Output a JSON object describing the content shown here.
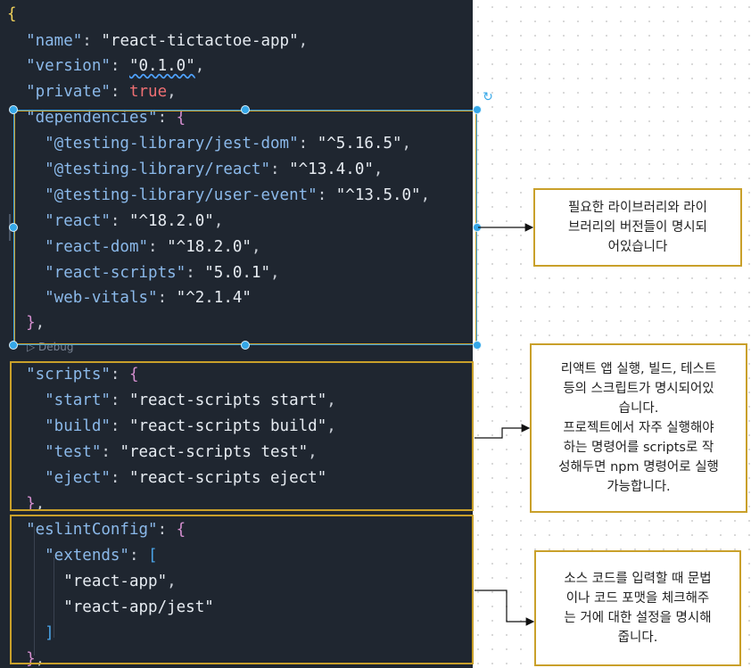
{
  "code_lines": [
    {
      "parts": [
        {
          "c": "yb",
          "t": "{"
        }
      ]
    },
    {
      "parts": [
        {
          "c": "k",
          "t": "  \"name\""
        },
        {
          "c": "p",
          "t": ": "
        },
        {
          "c": "s",
          "t": "\"react-tictactoe-app\""
        },
        {
          "c": "p",
          "t": ","
        }
      ]
    },
    {
      "parts": [
        {
          "c": "k",
          "t": "  \"version\""
        },
        {
          "c": "p",
          "t": ": "
        },
        {
          "c": "s squig",
          "t": "\"0.1.0\""
        },
        {
          "c": "p",
          "t": ","
        }
      ]
    },
    {
      "parts": [
        {
          "c": "k",
          "t": "  \"private\""
        },
        {
          "c": "p",
          "t": ": "
        },
        {
          "c": "t",
          "t": "true"
        },
        {
          "c": "p",
          "t": ","
        }
      ]
    },
    {
      "parts": [
        {
          "c": "k",
          "t": "  \"dependencies\""
        },
        {
          "c": "p",
          "t": ": "
        },
        {
          "c": "b",
          "t": "{"
        }
      ]
    },
    {
      "parts": [
        {
          "c": "k",
          "t": "    \"@testing-library/jest-dom\""
        },
        {
          "c": "p",
          "t": ": "
        },
        {
          "c": "s",
          "t": "\"^5.16.5\""
        },
        {
          "c": "p",
          "t": ","
        }
      ]
    },
    {
      "parts": [
        {
          "c": "k",
          "t": "    \"@testing-library/react\""
        },
        {
          "c": "p",
          "t": ": "
        },
        {
          "c": "s",
          "t": "\"^13.4.0\""
        },
        {
          "c": "p",
          "t": ","
        }
      ]
    },
    {
      "parts": [
        {
          "c": "k",
          "t": "    \"@testing-library/user-event\""
        },
        {
          "c": "p",
          "t": ": "
        },
        {
          "c": "s",
          "t": "\"^13.5.0\""
        },
        {
          "c": "p",
          "t": ","
        }
      ]
    },
    {
      "parts": [
        {
          "c": "k",
          "t": "    \"react\""
        },
        {
          "c": "p",
          "t": ": "
        },
        {
          "c": "s",
          "t": "\"^18.2.0\""
        },
        {
          "c": "p",
          "t": ","
        }
      ]
    },
    {
      "parts": [
        {
          "c": "k",
          "t": "    \"react-dom\""
        },
        {
          "c": "p",
          "t": ": "
        },
        {
          "c": "s",
          "t": "\"^18.2.0\""
        },
        {
          "c": "p",
          "t": ","
        }
      ]
    },
    {
      "parts": [
        {
          "c": "k",
          "t": "    \"react-scripts\""
        },
        {
          "c": "p",
          "t": ": "
        },
        {
          "c": "s",
          "t": "\"5.0.1\""
        },
        {
          "c": "p",
          "t": ","
        }
      ]
    },
    {
      "parts": [
        {
          "c": "k",
          "t": "    \"web-vitals\""
        },
        {
          "c": "p",
          "t": ": "
        },
        {
          "c": "s",
          "t": "\"^2.1.4\""
        }
      ]
    },
    {
      "parts": [
        {
          "c": "b",
          "t": "  }"
        },
        {
          "c": "p",
          "t": ","
        }
      ]
    },
    {
      "parts": []
    },
    {
      "parts": [
        {
          "c": "k",
          "t": "  \"scripts\""
        },
        {
          "c": "p",
          "t": ": "
        },
        {
          "c": "b",
          "t": "{"
        }
      ]
    },
    {
      "parts": [
        {
          "c": "k",
          "t": "    \"start\""
        },
        {
          "c": "p",
          "t": ": "
        },
        {
          "c": "s",
          "t": "\"react-scripts start\""
        },
        {
          "c": "p",
          "t": ","
        }
      ]
    },
    {
      "parts": [
        {
          "c": "k",
          "t": "    \"build\""
        },
        {
          "c": "p",
          "t": ": "
        },
        {
          "c": "s",
          "t": "\"react-scripts build\""
        },
        {
          "c": "p",
          "t": ","
        }
      ]
    },
    {
      "parts": [
        {
          "c": "k",
          "t": "    \"test\""
        },
        {
          "c": "p",
          "t": ": "
        },
        {
          "c": "s",
          "t": "\"react-scripts test\""
        },
        {
          "c": "p",
          "t": ","
        }
      ]
    },
    {
      "parts": [
        {
          "c": "k",
          "t": "    \"eject\""
        },
        {
          "c": "p",
          "t": ": "
        },
        {
          "c": "s",
          "t": "\"react-scripts eject\""
        }
      ]
    },
    {
      "parts": [
        {
          "c": "b",
          "t": "  }"
        },
        {
          "c": "p",
          "t": ","
        }
      ]
    },
    {
      "parts": [
        {
          "c": "k",
          "t": "  \"eslintConfig\""
        },
        {
          "c": "p",
          "t": ": "
        },
        {
          "c": "b",
          "t": "{"
        }
      ]
    },
    {
      "parts": [
        {
          "c": "k",
          "t": "    \"extends\""
        },
        {
          "c": "p",
          "t": ": "
        },
        {
          "c": "br",
          "t": "["
        }
      ]
    },
    {
      "parts": [
        {
          "c": "s",
          "t": "      \"react-app\""
        },
        {
          "c": "p",
          "t": ","
        }
      ]
    },
    {
      "parts": [
        {
          "c": "s",
          "t": "      \"react-app/jest\""
        }
      ]
    },
    {
      "parts": [
        {
          "c": "br",
          "t": "    ]"
        }
      ]
    },
    {
      "parts": [
        {
          "c": "b",
          "t": "  }"
        },
        {
          "c": "p",
          "t": ","
        }
      ]
    }
  ],
  "debug_label": "▷ Debug",
  "notes": {
    "dependencies": "필요한 라이브러리와 라이\n브러리의 버전들이 명시되\n어있습니다",
    "scripts": "리액트 앱 실행, 빌드, 테스트\n등의 스크립트가 명시되어있\n습니다.\n프로젝트에서 자주 실행해야\n하는 명령어를 scripts로 작\n성해두면 npm 명령어로 실행\n가능합니다.",
    "eslint": "소스 코드를 입력할 때 문법\n이나 코드 포맷을 체크해주\n는 거에 대한 설정을 명시해\n줍니다."
  },
  "colors": {
    "editor_bg": "#1f2630",
    "frame": "#c9a02a",
    "selection": "#35a7e8"
  }
}
